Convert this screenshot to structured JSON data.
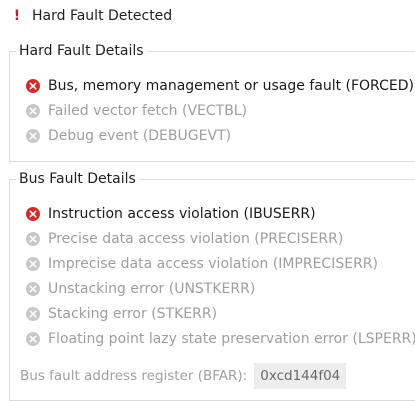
{
  "header": {
    "icon": "exclamation-icon",
    "title": "Hard Fault Detected"
  },
  "hard_fault_details": {
    "title": "Hard Fault Details",
    "items": [
      {
        "label": "Bus, memory management or usage fault (FORCED)",
        "active": true
      },
      {
        "label": "Failed vector fetch (VECTBL)",
        "active": false
      },
      {
        "label": "Debug event (DEBUGEVT)",
        "active": false
      }
    ]
  },
  "bus_fault_details": {
    "title": "Bus Fault Details",
    "items": [
      {
        "label": "Instruction access violation (IBUSERR)",
        "active": true
      },
      {
        "label": "Precise data access violation (PRECISERR)",
        "active": false
      },
      {
        "label": "Imprecise data access violation (IMPRECISERR)",
        "active": false
      },
      {
        "label": "Unstacking error (UNSTKERR)",
        "active": false
      },
      {
        "label": "Stacking error (STKERR)",
        "active": false
      },
      {
        "label": "Floating point lazy state preservation error (LSPERR)",
        "active": false
      }
    ],
    "bfar_label": "Bus fault address register (BFAR):",
    "bfar_value": "0xcd144f04"
  },
  "colors": {
    "active_icon": "#d7282c",
    "inactive_icon": "#c8c8c8",
    "title_icon": "#d11a1a"
  }
}
